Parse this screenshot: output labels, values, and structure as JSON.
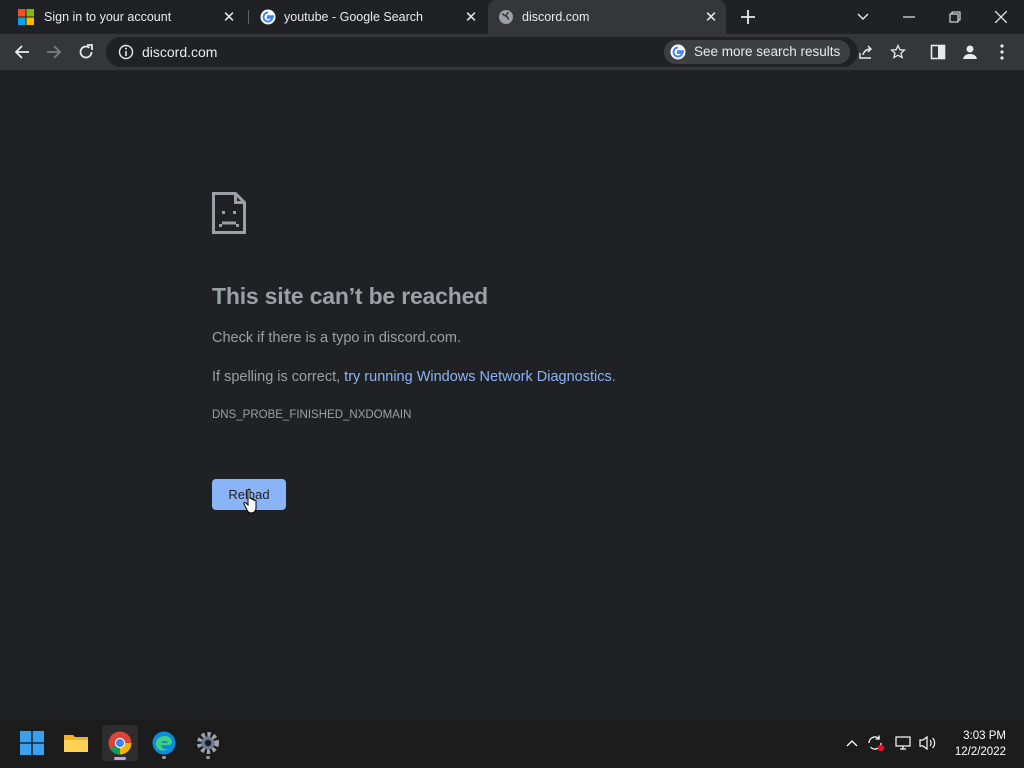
{
  "tabs": [
    {
      "title": "Sign in to your account",
      "icon": "microsoft-icon",
      "active": false
    },
    {
      "title": "youtube - Google Search",
      "icon": "google-icon",
      "active": false
    },
    {
      "title": "discord.com",
      "icon": "globe-icon",
      "active": true
    }
  ],
  "omnibox": {
    "url": "discord.com",
    "chip_label": "See more search results"
  },
  "error": {
    "title": "This site can’t be reached",
    "line1": "Check if there is a typo in discord.com.",
    "line2_prefix": "If spelling is correct, ",
    "line2_link": "try running Windows Network Diagnostics",
    "line2_suffix": ".",
    "code": "DNS_PROBE_FINISHED_NXDOMAIN",
    "reload_label": "Reload"
  },
  "taskbar": {
    "apps": [
      "start-icon",
      "file-explorer-icon",
      "chrome-icon",
      "edge-icon",
      "settings-icon"
    ],
    "time": "3:03 PM",
    "date": "12/2/2022"
  },
  "colors": {
    "background": "#202124",
    "toolbar": "#35363a",
    "link": "#8ab4f8",
    "button": "#8ab4f8",
    "text_muted": "#9aa0a6"
  }
}
